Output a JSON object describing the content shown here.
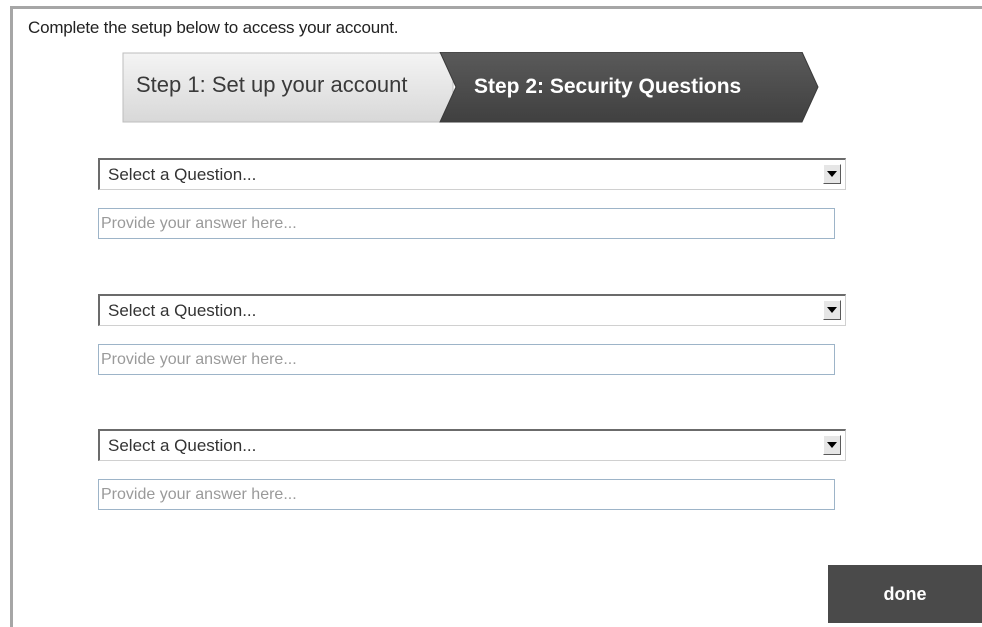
{
  "intro_text": "Complete the setup below to access your account.",
  "wizard": {
    "step1_label": "Step 1: Set up your account",
    "step2_label": "Step 2: Security Questions",
    "active_step": 2,
    "colors": {
      "inactive_step_bg": "#e2e2e2",
      "active_step_bg": "#4d4d4d"
    }
  },
  "questions": [
    {
      "select_value": "Select a Question...",
      "answer_placeholder": "Provide your answer here...",
      "answer_value": ""
    },
    {
      "select_value": "Select a Question...",
      "answer_placeholder": "Provide your answer here...",
      "answer_value": ""
    },
    {
      "select_value": "Select a Question...",
      "answer_placeholder": "Provide your answer here...",
      "answer_value": ""
    }
  ],
  "done_label": "done",
  "icons": {
    "dropdown": "chevron-down-icon"
  }
}
